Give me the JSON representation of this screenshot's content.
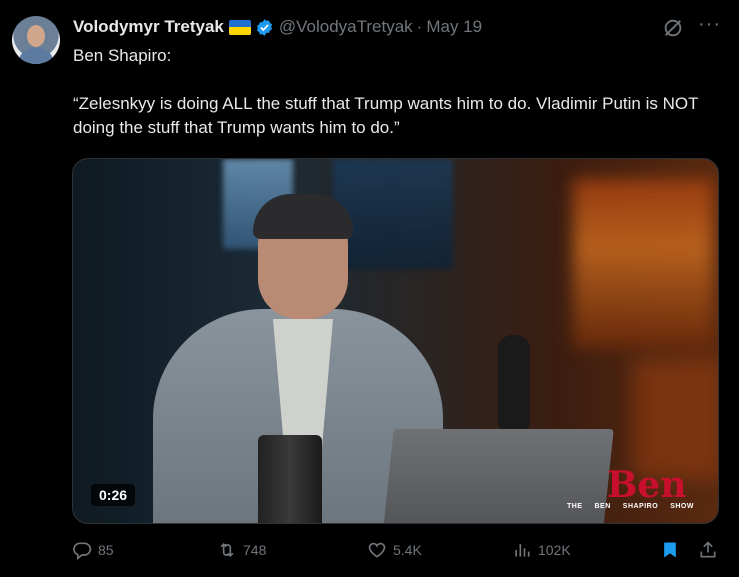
{
  "tweet": {
    "author_name": "Volodymyr Tretyak",
    "handle": "@VolodyaTretyak",
    "separator": "·",
    "date": "May 19",
    "text_line1": "Ben Shapiro:",
    "text_line2": "“Zelesnkyy is doing ALL the stuff that Trump wants him to do. Vladimir Putin is NOT doing the stuff that Trump wants him to do.”"
  },
  "media": {
    "duration": "0:26",
    "logo_main": "Ben",
    "logo_sub": [
      "THE",
      "BEN",
      "SHAPIRO",
      "SHOW"
    ]
  },
  "actions": {
    "replies": "85",
    "reposts": "748",
    "likes": "5.4K",
    "views": "102K"
  },
  "icons": {
    "verified": "verified-badge-icon",
    "flag": "ukraine-flag-icon",
    "grok": "grok-icon",
    "more": "more-icon",
    "reply": "reply-icon",
    "repost": "repost-icon",
    "like": "heart-icon",
    "views": "views-icon",
    "bookmark": "bookmark-icon",
    "share": "share-icon"
  },
  "colors": {
    "accent": "#1d9bf0",
    "muted": "#71767b",
    "text": "#e7e9ea",
    "background": "#000000"
  }
}
